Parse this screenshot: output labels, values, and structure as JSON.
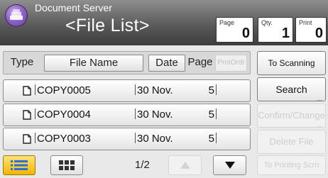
{
  "header": {
    "app_title": "Document Server",
    "page_title": "<File List>",
    "counters": [
      {
        "label": "Page",
        "value": "0"
      },
      {
        "label": "Qty.",
        "value": "1"
      },
      {
        "label": "Print",
        "value": "0"
      }
    ]
  },
  "columns": {
    "type": "Type",
    "file_name": "File Name",
    "date": "Date",
    "page": "Page",
    "print_order": "PrntOrdr"
  },
  "files": [
    {
      "name": "COPY0005",
      "date": "30 Nov.",
      "pages": "5"
    },
    {
      "name": "COPY0004",
      "date": "30 Nov.",
      "pages": "5"
    },
    {
      "name": "COPY0003",
      "date": "30 Nov.",
      "pages": "5"
    }
  ],
  "side_buttons": {
    "to_scanning": "To Scanning Scrn.",
    "search": "Search",
    "confirm_change": "Confirm/Change",
    "delete_file": "Delete File",
    "to_printing": "To Printing Scrn"
  },
  "pager": {
    "text": "1/2"
  },
  "icons": {
    "app": "document-server-icon",
    "doc": "document-icon",
    "list_view": "list-view-icon",
    "grid_view": "grid-view-icon",
    "up": "arrow-up-icon",
    "down": "arrow-down-icon"
  },
  "colors": {
    "header_dark": "#3d3d3d",
    "selected_view": "#f3b600",
    "accent_icon": "#8f63c7"
  }
}
